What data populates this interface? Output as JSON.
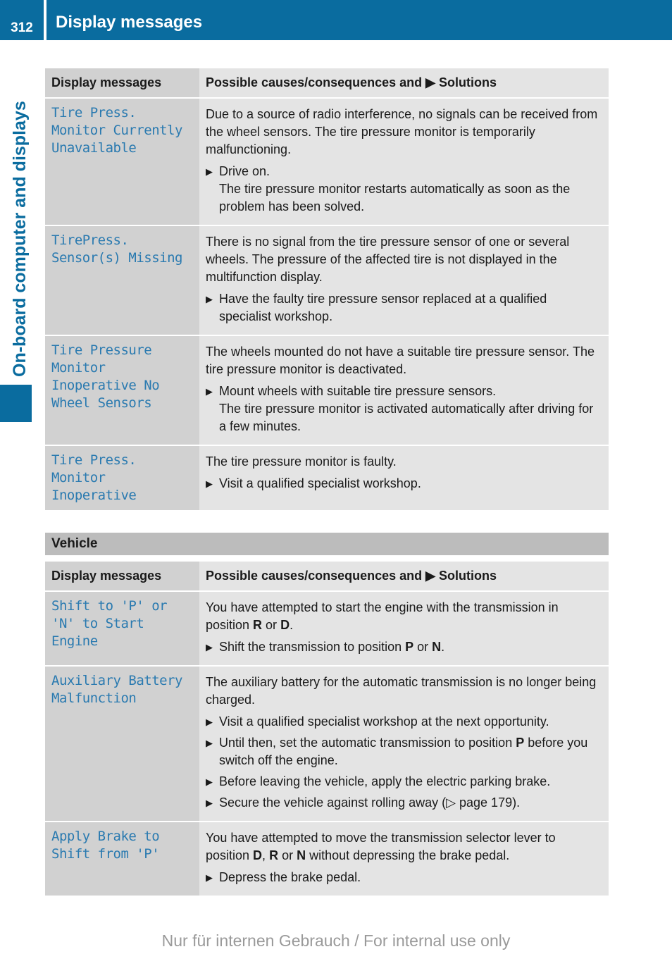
{
  "header": {
    "page_number": "312",
    "title": "Display messages"
  },
  "sidebar": {
    "label": "On-board computer and displays"
  },
  "table1": {
    "col1": "Display messages",
    "col2": "Possible causes/consequences and ▶ Solutions",
    "rows": [
      {
        "message": "Tire Press.\nMonitor Currently\nUnavailable",
        "description": "Due to a source of radio interference, no signals can be received from the wheel sensors. The tire pressure monitor is temporarily malfunctioning.",
        "steps": [
          {
            "text": "Drive on.",
            "note": "The tire pressure monitor restarts automatically as soon as the problem has been solved."
          }
        ]
      },
      {
        "message": "TirePress.\nSensor(s) Missing",
        "description": "There is no signal from the tire pressure sensor of one or several wheels. The pressure of the affected tire is not displayed in the multifunction display.",
        "steps": [
          {
            "text": "Have the faulty tire pressure sensor replaced at a qualified specialist workshop."
          }
        ]
      },
      {
        "message": "Tire Pressure\nMonitor\nInoperative No\nWheel Sensors",
        "description": "The wheels mounted do not have a suitable tire pressure sensor. The tire pressure monitor is deactivated.",
        "steps": [
          {
            "text": "Mount wheels with suitable tire pressure sensors.",
            "note": "The tire pressure monitor is activated automatically after driving for a few minutes."
          }
        ]
      },
      {
        "message": "Tire Press.\nMonitor\nInoperative",
        "description": "The tire pressure monitor is faulty.",
        "steps": [
          {
            "text": "Visit a qualified specialist workshop."
          }
        ]
      }
    ]
  },
  "section": {
    "title": "Vehicle"
  },
  "table2": {
    "col1": "Display messages",
    "col2": "Possible causes/consequences and ▶ Solutions",
    "rows": [
      {
        "message": "Shift to 'P' or\n'N' to Start Engine",
        "description_parts": [
          "You have attempted to start the engine with the transmission in position ",
          "R",
          " or ",
          "D",
          "."
        ],
        "steps": [
          {
            "parts": [
              "Shift the transmission to position ",
              "P",
              " or ",
              "N",
              "."
            ]
          }
        ]
      },
      {
        "message": "Auxiliary Battery\nMalfunction",
        "description": "The auxiliary battery for the automatic transmission is no longer being charged.",
        "steps": [
          {
            "text": "Visit a qualified specialist workshop at the next opportunity."
          },
          {
            "parts": [
              "Until then, set the automatic transmission to position ",
              "P",
              " before you switch off the engine."
            ]
          },
          {
            "text": "Before leaving the vehicle, apply the electric parking brake."
          },
          {
            "text": "Secure the vehicle against rolling away (▷ page 179)."
          }
        ]
      },
      {
        "message": "Apply Brake to\nShift from 'P'",
        "description_parts": [
          "You have attempted to move the transmission selector lever to position ",
          "D",
          ", ",
          "R",
          " or ",
          "N",
          " without depressing the brake pedal."
        ],
        "steps": [
          {
            "text": "Depress the brake pedal."
          }
        ]
      }
    ]
  },
  "footer": {
    "text": "Nur für internen Gebrauch / For internal use only"
  },
  "icons": {
    "step_arrow": "▶"
  },
  "colors": {
    "brand_blue": "#0a6c9f",
    "message_text": "#2a7ab0"
  }
}
